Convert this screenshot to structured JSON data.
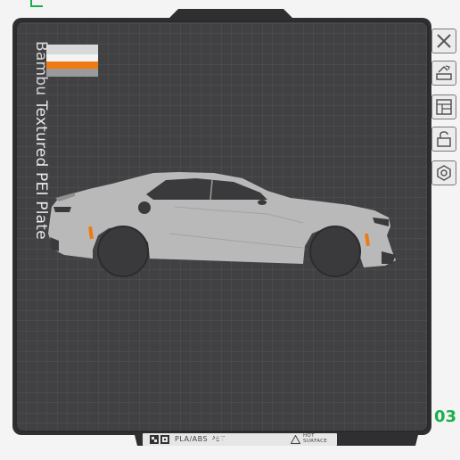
{
  "plate": {
    "brand": "Bambu",
    "name": "Textured PEI Plate",
    "index": "03",
    "material_codes": "PLA/ABS/PETG",
    "hot_surface_line1": "HOT",
    "hot_surface_line2": "SURFACE"
  },
  "filament_swatch": {
    "colors": [
      "#d8d8d8",
      "#f3f3f3",
      "#f07a12",
      "#9a9a9a"
    ]
  },
  "colors": {
    "plate_surface": "#414144",
    "plate_border": "#2f2f31",
    "grid_line": "#58585c",
    "car_body": "#b9b9b9",
    "accent_green": "#18b04a",
    "accent_orange": "#f07a12"
  },
  "toolbar": {
    "buttons": [
      {
        "icon": "close-icon"
      },
      {
        "icon": "auto-orient-icon"
      },
      {
        "icon": "arrange-icon"
      },
      {
        "icon": "lock-icon"
      },
      {
        "icon": "settings-gear-icon"
      }
    ]
  },
  "model": {
    "description_icon": "sports-car-model"
  }
}
